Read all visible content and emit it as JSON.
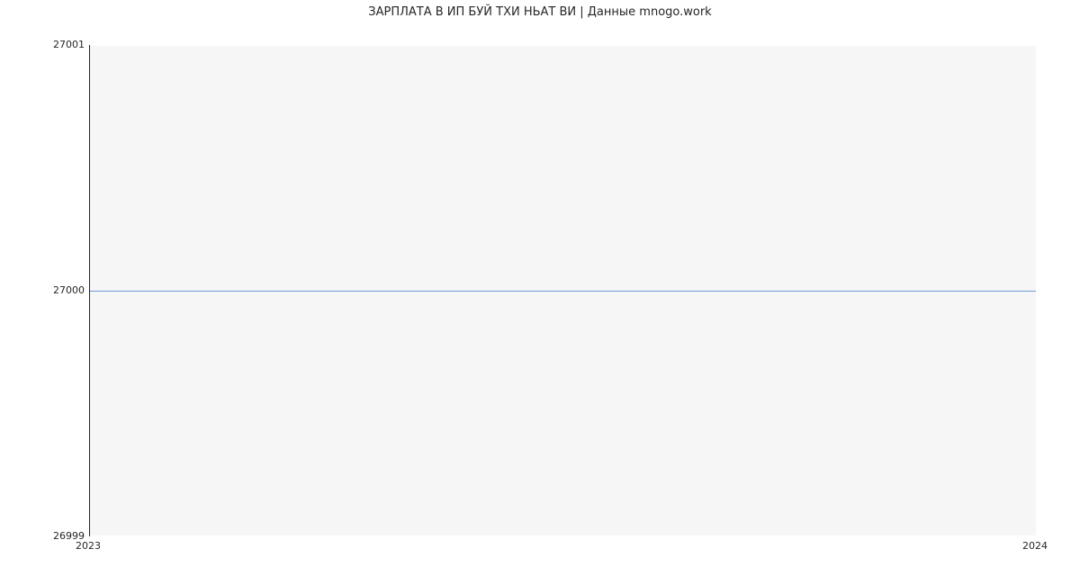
{
  "chart_data": {
    "type": "line",
    "title": "ЗАРПЛАТА В ИП БУЙ ТХИ НЬАТ ВИ | Данные mnogo.work",
    "xlabel": "",
    "ylabel": "",
    "x": [
      "2023",
      "2024"
    ],
    "values": [
      27000,
      27000
    ],
    "xlim": [
      "2023",
      "2024"
    ],
    "ylim": [
      26999,
      27001
    ],
    "y_ticks": [
      26999,
      27000,
      27001
    ],
    "x_ticks": [
      "2023",
      "2024"
    ],
    "line_color": "#6c9ad2",
    "grid_color": "#ffffff",
    "plot_bg": "#f6f6f6"
  }
}
